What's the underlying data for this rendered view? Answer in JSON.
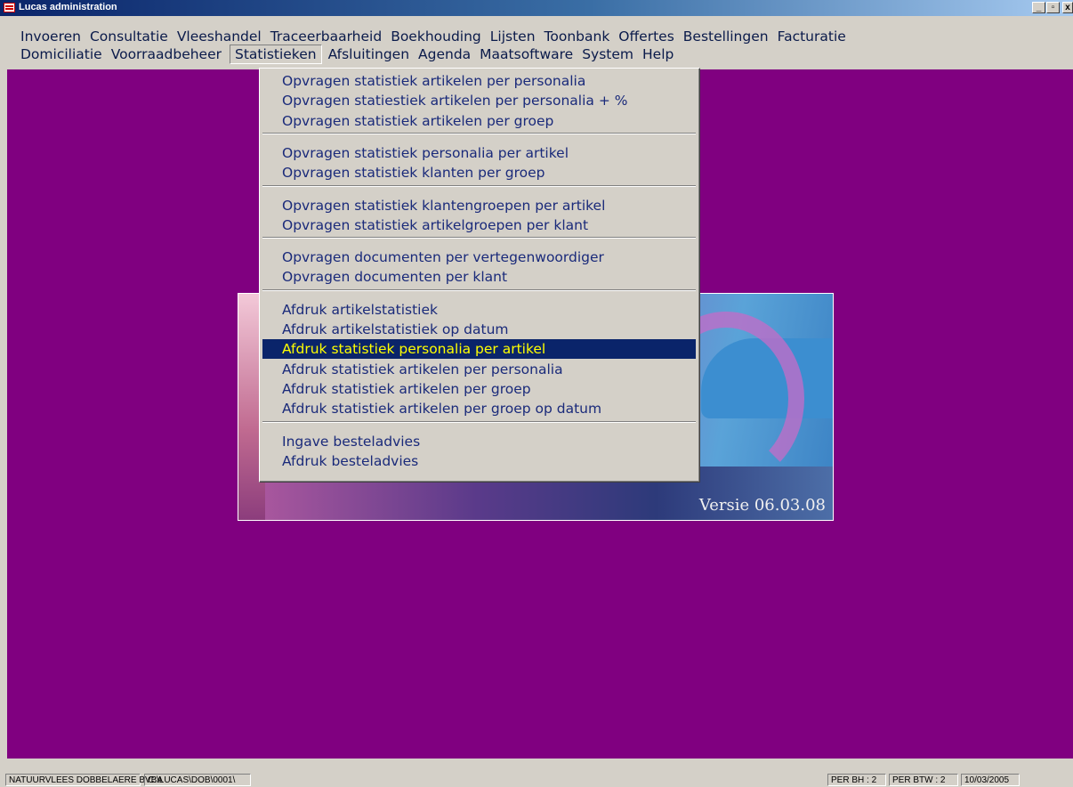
{
  "window": {
    "title": "Lucas administration",
    "minimize": "_",
    "restore": "▫",
    "close": "x"
  },
  "menubar": {
    "row1": [
      "Invoeren",
      "Consultatie",
      "Vleeshandel",
      "Traceerbaarheid",
      "Boekhouding",
      "Lijsten",
      "Toonbank",
      "Offertes",
      "Bestellingen",
      "Facturatie"
    ],
    "row2": [
      "Domiciliatie",
      "Voorraadbeheer",
      "Statistieken",
      "Afsluitingen",
      "Agenda",
      "Maatsoftware",
      "System",
      "Help"
    ],
    "open_menu": "Statistieken"
  },
  "dropdown": {
    "groups": [
      [
        "Opvragen statistiek artikelen per personalia",
        "Opvragen statiestiek artikelen per personalia + %",
        "Opvragen statistiek artikelen per groep"
      ],
      [
        "Opvragen statistiek personalia per artikel",
        "Opvragen statistiek klanten per groep"
      ],
      [
        "Opvragen statistiek klantengroepen per artikel",
        "Opvragen statistiek artikelgroepen per klant"
      ],
      [
        "Opvragen documenten per vertegenwoordiger",
        "Opvragen documenten per klant"
      ],
      [
        "Afdruk artikelstatistiek",
        "Afdruk artikelstatistiek op datum",
        "Afdruk statistiek personalia per artikel",
        "Afdruk statistiek artikelen per personalia",
        "Afdruk statistiek artikelen per groep",
        "Afdruk statistiek artikelen per groep op datum"
      ],
      [
        "Ingave besteladvies",
        "Afdruk besteladvies"
      ]
    ],
    "highlighted": "Afdruk statistiek personalia per artikel"
  },
  "splash": {
    "version": "Versie 06.03.08"
  },
  "statusbar": {
    "company": "NATUURVLEES DOBBELAERE BVBA",
    "path": "C:\\LUCAS\\DOB\\0001\\",
    "per_bh": "PER BH :   2",
    "per_btw": "PER BTW :   2",
    "date": "10/03/2005"
  },
  "colors": {
    "workspace": "#800080",
    "menu_text": "#0a1a4a",
    "highlight_bg": "#0a246a",
    "highlight_text": "#ffff00"
  }
}
